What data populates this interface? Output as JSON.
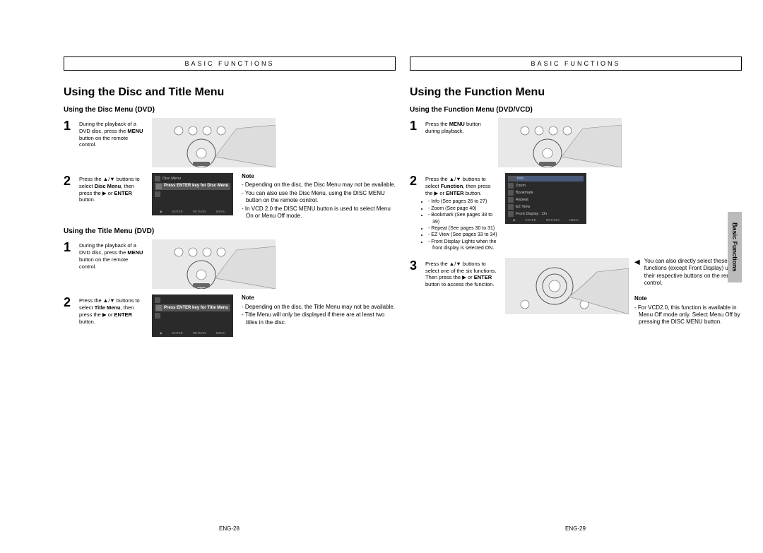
{
  "header": "BASIC FUNCTIONS",
  "left": {
    "title": "Using the Disc and Title Menu",
    "sectionA": {
      "sub": "Using the Disc Menu (DVD)",
      "step1": "During the playback of a DVD disc, press the MENU button on the remote control.",
      "step2": "Press the ▲/▼ buttons to select Disc Menu, then press the ▶ or ENTER button.",
      "screenMsg": "Press ENTER key for Disc Menu",
      "noteTitle": "Note",
      "notes": [
        "Depending on the disc, the Disc Menu may not be available.",
        "You can also use the Disc Menu, using the DISC MENU button on the remote control.",
        "In VCD 2.0 the DISC MENU button is used to select Menu On or Menu Off mode."
      ]
    },
    "sectionB": {
      "sub": "Using the Title Menu (DVD)",
      "step1": "During the playback of a DVD disc, press the MENU button on the remote control.",
      "step2": "Press the ▲/▼ buttons to select Title Menu, then press the ▶ or ENTER button.",
      "screenMsg": "Press ENTER key for Title Menu",
      "noteTitle": "Note",
      "notes": [
        "Depending on the disc, the Title Menu may not be available.",
        "Title Menu will only be displayed if there are at least two titles in the disc."
      ]
    },
    "pageNum": "ENG-28"
  },
  "right": {
    "title": "Using the Function Menu",
    "sub": "Using the Function Menu (DVD/VCD)",
    "step1": "Press the MENU button during playback.",
    "step2_intro": "Press the ▲/▼ buttons to select Function, then press the ▶ or ENTER button.",
    "step2_items": [
      "Info (See pages 26 to 27)",
      "Zoom (See page 40)",
      "Bookmark (See pages 38 to 39)",
      "Repeat (See pages 30 to 31)",
      "EZ View (See pages 33 to 34)",
      "Front Display Lights when the front display is selected ON."
    ],
    "screenItems": [
      "Info",
      "Zoom",
      "Bookmark",
      "Repeat",
      "EZ View",
      "Front Display : On"
    ],
    "step3": "Press the ▲/▼ buttons to select one of the six functions. Then press the ▶ or ENTER button to access the function.",
    "callout": "You can also directly select these functions (except Front Display) using their respective buttons on the remote control.",
    "noteTitle": "Note",
    "notes": [
      "For VCD2.0, this function is available in Menu Off mode only. Select Menu Off by pressing the DISC MENU button."
    ],
    "sideTab": "Basic Functions",
    "pageNum": "ENG-29"
  },
  "screenFooter": [
    "ENTER",
    "RETURN",
    "MENU"
  ],
  "osd": {
    "discMenu": "Disc Menu",
    "titleMenu": "Title Menu"
  }
}
